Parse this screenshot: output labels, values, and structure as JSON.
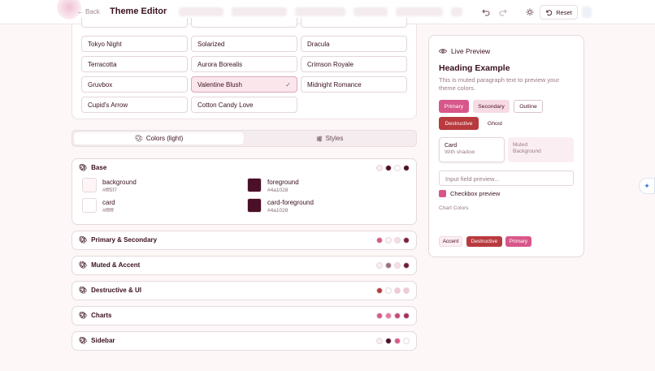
{
  "topbar": {
    "back_label": "Back",
    "title": "Theme Editor",
    "reset_label": "Reset"
  },
  "themes": [
    {
      "label": "Tokyo Night"
    },
    {
      "label": "Solarized"
    },
    {
      "label": "Dracula"
    },
    {
      "label": "Terracotta"
    },
    {
      "label": "Aurora Borealis"
    },
    {
      "label": "Crimson Royale"
    },
    {
      "label": "Gruvbox"
    },
    {
      "label": "Valentine Blush"
    },
    {
      "label": "Midnight Romance"
    },
    {
      "label": "Cupid's Arrow"
    },
    {
      "label": "Cotton Candy Love"
    }
  ],
  "selected_theme": "Valentine Blush",
  "tabs": {
    "colors": "Colors (light)",
    "styles": "Styles"
  },
  "base": {
    "title": "Base",
    "swatches": [
      {
        "name": "background",
        "hex": "#fff5f7"
      },
      {
        "name": "foreground",
        "hex": "#4a1028"
      },
      {
        "name": "card",
        "hex": "#ffffff"
      },
      {
        "name": "card-foreground",
        "hex": "#4a1028"
      }
    ],
    "dots": [
      "#fbeaf0",
      "#4a1028",
      "#ffffff",
      "#4a1028"
    ]
  },
  "sections": [
    {
      "title": "Primary & Secondary",
      "dots": [
        "#d8578a",
        "#fdf2f5",
        "#f7dbe4",
        "#7a1f45"
      ]
    },
    {
      "title": "Muted & Accent",
      "dots": [
        "#fbeef2",
        "#9a6f80",
        "#f8dce6",
        "#6a1a3a"
      ]
    },
    {
      "title": "Destructive & UI",
      "dots": [
        "#b83a3e",
        "#ffffff",
        "#f3c8d6",
        "#f3c8d6"
      ]
    },
    {
      "title": "Charts",
      "dots": [
        "#d8578a",
        "#e8789f",
        "#c44a78",
        "#a62f5e"
      ]
    },
    {
      "title": "Sidebar",
      "dots": [
        "#fbeef2",
        "#4a1028",
        "#d8578a",
        "#ffffff"
      ]
    }
  ],
  "preview": {
    "title": "Live Preview",
    "heading": "Heading Example",
    "paragraph": "This is muted paragraph text to preview your theme colors.",
    "buttons": {
      "primary": "Primary",
      "secondary": "Secondary",
      "outline": "Outline",
      "destructive": "Destructive",
      "ghost": "Ghost"
    },
    "card": {
      "title": "Card",
      "subtitle": "With shadow"
    },
    "muted": {
      "title": "Muted",
      "subtitle": "Background"
    },
    "input_placeholder": "Input field preview...",
    "checkbox_label": "Checkbox preview",
    "chart_colors_label": "Chart Colors",
    "badges": {
      "accent": "Accent",
      "destructive": "Destructive",
      "primary": "Primary"
    }
  },
  "colors": {
    "primary": "#d8578a",
    "destructive": "#b83a3e",
    "foreground": "#4a1028",
    "secondary": "#f7dbe4"
  }
}
